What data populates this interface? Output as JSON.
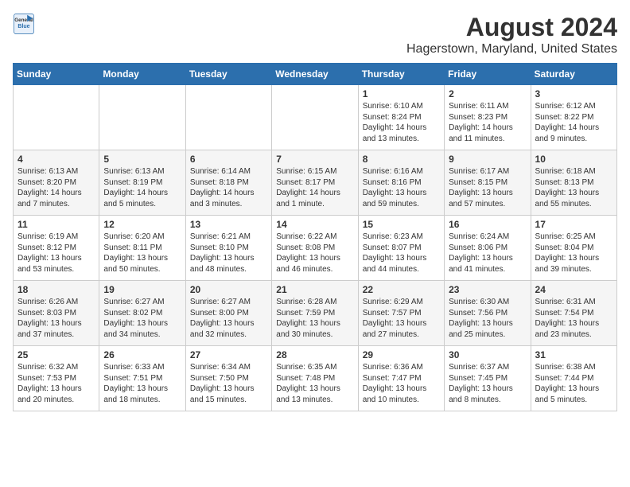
{
  "logo": {
    "text_general": "General",
    "text_blue": "Blue"
  },
  "title": "August 2024",
  "subtitle": "Hagerstown, Maryland, United States",
  "headers": [
    "Sunday",
    "Monday",
    "Tuesday",
    "Wednesday",
    "Thursday",
    "Friday",
    "Saturday"
  ],
  "weeks": [
    [
      {
        "day": "",
        "info": ""
      },
      {
        "day": "",
        "info": ""
      },
      {
        "day": "",
        "info": ""
      },
      {
        "day": "",
        "info": ""
      },
      {
        "day": "1",
        "info": "Sunrise: 6:10 AM\nSunset: 8:24 PM\nDaylight: 14 hours\nand 13 minutes."
      },
      {
        "day": "2",
        "info": "Sunrise: 6:11 AM\nSunset: 8:23 PM\nDaylight: 14 hours\nand 11 minutes."
      },
      {
        "day": "3",
        "info": "Sunrise: 6:12 AM\nSunset: 8:22 PM\nDaylight: 14 hours\nand 9 minutes."
      }
    ],
    [
      {
        "day": "4",
        "info": "Sunrise: 6:13 AM\nSunset: 8:20 PM\nDaylight: 14 hours\nand 7 minutes."
      },
      {
        "day": "5",
        "info": "Sunrise: 6:13 AM\nSunset: 8:19 PM\nDaylight: 14 hours\nand 5 minutes."
      },
      {
        "day": "6",
        "info": "Sunrise: 6:14 AM\nSunset: 8:18 PM\nDaylight: 14 hours\nand 3 minutes."
      },
      {
        "day": "7",
        "info": "Sunrise: 6:15 AM\nSunset: 8:17 PM\nDaylight: 14 hours\nand 1 minute."
      },
      {
        "day": "8",
        "info": "Sunrise: 6:16 AM\nSunset: 8:16 PM\nDaylight: 13 hours\nand 59 minutes."
      },
      {
        "day": "9",
        "info": "Sunrise: 6:17 AM\nSunset: 8:15 PM\nDaylight: 13 hours\nand 57 minutes."
      },
      {
        "day": "10",
        "info": "Sunrise: 6:18 AM\nSunset: 8:13 PM\nDaylight: 13 hours\nand 55 minutes."
      }
    ],
    [
      {
        "day": "11",
        "info": "Sunrise: 6:19 AM\nSunset: 8:12 PM\nDaylight: 13 hours\nand 53 minutes."
      },
      {
        "day": "12",
        "info": "Sunrise: 6:20 AM\nSunset: 8:11 PM\nDaylight: 13 hours\nand 50 minutes."
      },
      {
        "day": "13",
        "info": "Sunrise: 6:21 AM\nSunset: 8:10 PM\nDaylight: 13 hours\nand 48 minutes."
      },
      {
        "day": "14",
        "info": "Sunrise: 6:22 AM\nSunset: 8:08 PM\nDaylight: 13 hours\nand 46 minutes."
      },
      {
        "day": "15",
        "info": "Sunrise: 6:23 AM\nSunset: 8:07 PM\nDaylight: 13 hours\nand 44 minutes."
      },
      {
        "day": "16",
        "info": "Sunrise: 6:24 AM\nSunset: 8:06 PM\nDaylight: 13 hours\nand 41 minutes."
      },
      {
        "day": "17",
        "info": "Sunrise: 6:25 AM\nSunset: 8:04 PM\nDaylight: 13 hours\nand 39 minutes."
      }
    ],
    [
      {
        "day": "18",
        "info": "Sunrise: 6:26 AM\nSunset: 8:03 PM\nDaylight: 13 hours\nand 37 minutes."
      },
      {
        "day": "19",
        "info": "Sunrise: 6:27 AM\nSunset: 8:02 PM\nDaylight: 13 hours\nand 34 minutes."
      },
      {
        "day": "20",
        "info": "Sunrise: 6:27 AM\nSunset: 8:00 PM\nDaylight: 13 hours\nand 32 minutes."
      },
      {
        "day": "21",
        "info": "Sunrise: 6:28 AM\nSunset: 7:59 PM\nDaylight: 13 hours\nand 30 minutes."
      },
      {
        "day": "22",
        "info": "Sunrise: 6:29 AM\nSunset: 7:57 PM\nDaylight: 13 hours\nand 27 minutes."
      },
      {
        "day": "23",
        "info": "Sunrise: 6:30 AM\nSunset: 7:56 PM\nDaylight: 13 hours\nand 25 minutes."
      },
      {
        "day": "24",
        "info": "Sunrise: 6:31 AM\nSunset: 7:54 PM\nDaylight: 13 hours\nand 23 minutes."
      }
    ],
    [
      {
        "day": "25",
        "info": "Sunrise: 6:32 AM\nSunset: 7:53 PM\nDaylight: 13 hours\nand 20 minutes."
      },
      {
        "day": "26",
        "info": "Sunrise: 6:33 AM\nSunset: 7:51 PM\nDaylight: 13 hours\nand 18 minutes."
      },
      {
        "day": "27",
        "info": "Sunrise: 6:34 AM\nSunset: 7:50 PM\nDaylight: 13 hours\nand 15 minutes."
      },
      {
        "day": "28",
        "info": "Sunrise: 6:35 AM\nSunset: 7:48 PM\nDaylight: 13 hours\nand 13 minutes."
      },
      {
        "day": "29",
        "info": "Sunrise: 6:36 AM\nSunset: 7:47 PM\nDaylight: 13 hours\nand 10 minutes."
      },
      {
        "day": "30",
        "info": "Sunrise: 6:37 AM\nSunset: 7:45 PM\nDaylight: 13 hours\nand 8 minutes."
      },
      {
        "day": "31",
        "info": "Sunrise: 6:38 AM\nSunset: 7:44 PM\nDaylight: 13 hours\nand 5 minutes."
      }
    ]
  ]
}
